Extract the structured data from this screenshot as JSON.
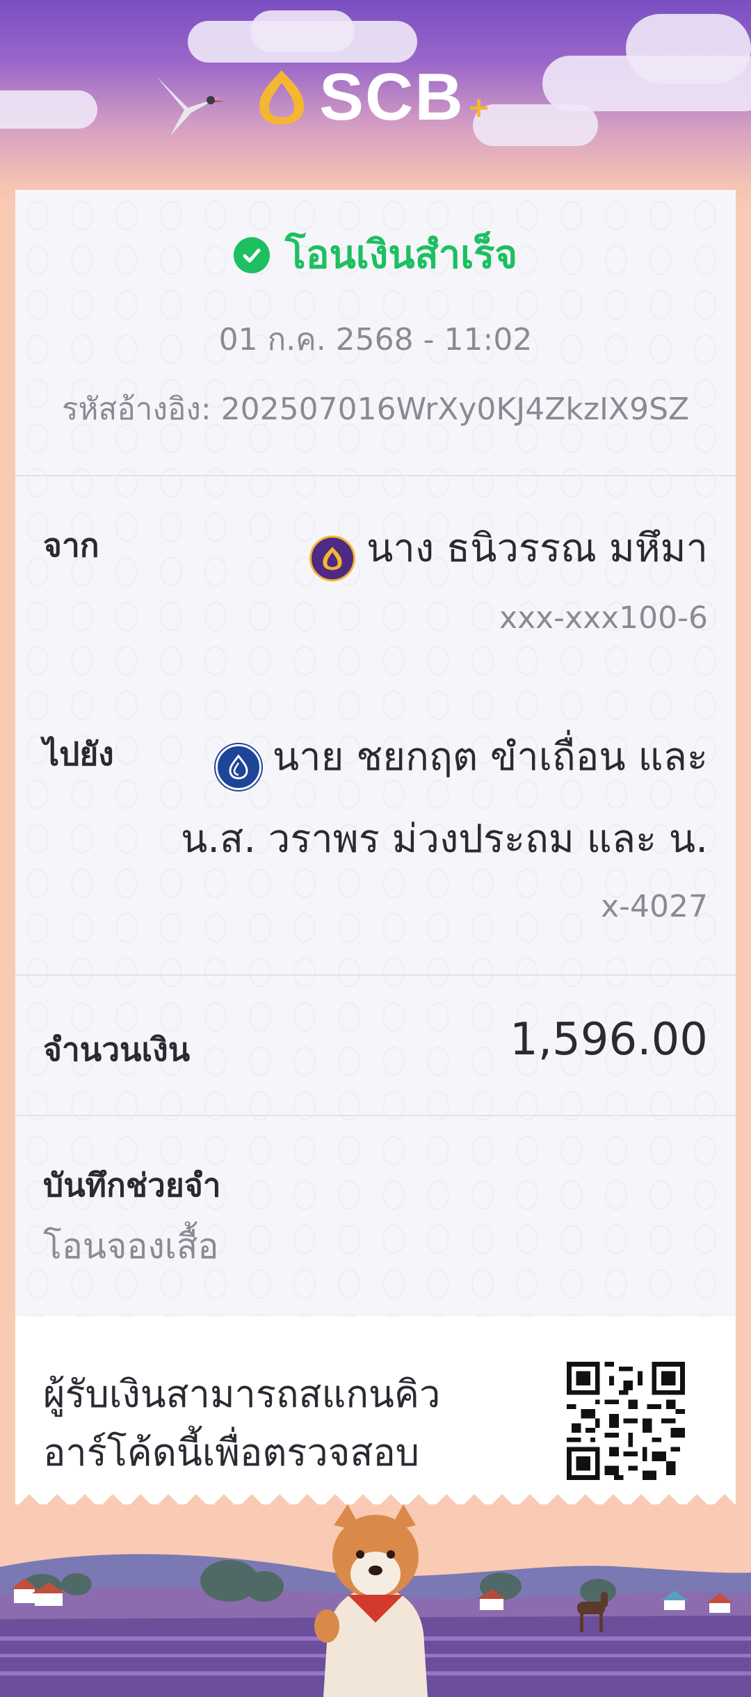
{
  "header": {
    "logo_text": "SCB",
    "logo_plus": "+"
  },
  "receipt": {
    "status": "โอนเงินสำเร็จ",
    "datetime": "01 ก.ค. 2568 - 11:02",
    "reference": "รหัสอ้างอิง: 202507016WrXy0KJ4ZkzIX9SZ",
    "from": {
      "label": "จาก",
      "name": "นาง ธนิวรรณ มหึมา",
      "account": "xxx-xxx100-6"
    },
    "to": {
      "label": "ไปยัง",
      "name_line1": "นาย ชยกฤต ขำเถื่อน และ",
      "name_line2": "น.ส. วราพร ม่วงประถม และ น.",
      "account": "x-4027"
    },
    "amount": {
      "label": "จำนวนเงิน",
      "value": "1,596.00"
    },
    "memo": {
      "label": "บันทึกช่วยจำ",
      "value": "โอนจองเสื้อ"
    },
    "qr": {
      "text_line1": "ผู้รับเงินสามารถสแกนคิว",
      "text_line2": "อาร์โค้ดนี้เพื่อตรวจสอบ"
    }
  },
  "colors": {
    "success_green": "#1dbf61",
    "scb_purple": "#4e2a84",
    "scb_gold": "#f5b731",
    "recipient_bank_blue": "#1e4598"
  },
  "icons": {
    "status": "check-circle-icon",
    "from_bank": "scb-bank-icon",
    "to_bank": "bbl-bank-icon",
    "qr": "qr-code-icon"
  }
}
